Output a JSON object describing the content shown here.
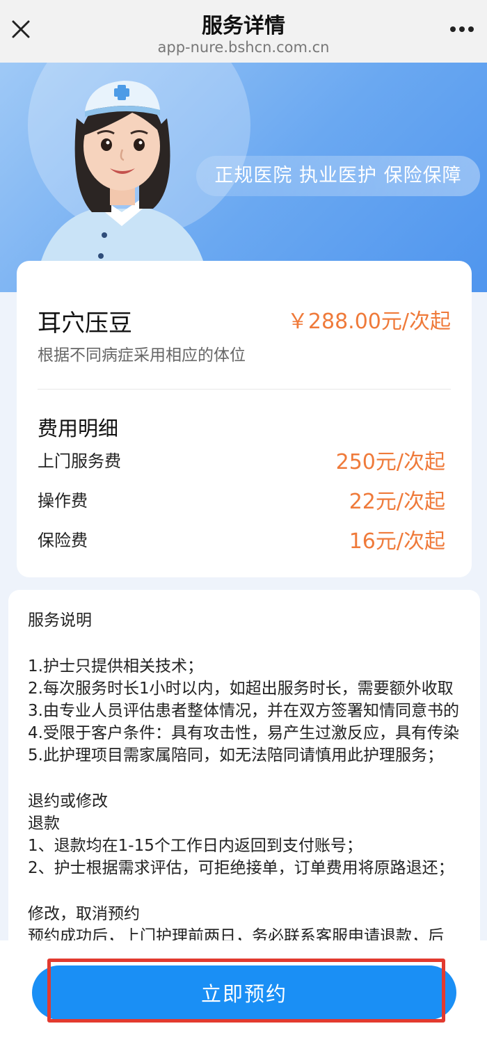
{
  "topbar": {
    "title": "服务详情",
    "url": "app-nure.bshcn.com.cn",
    "close_icon": "close-icon",
    "more_icon": "more-dots-icon"
  },
  "hero": {
    "slogan": "正规医院 执业医护 保险保障",
    "avatar": "nurse-avatar"
  },
  "service": {
    "name": "耳穴压豆",
    "price": "￥288.00元/次起",
    "description": "根据不同病症采用相应的体位"
  },
  "fees": {
    "title": "费用明细",
    "items": [
      {
        "label": "上门服务费",
        "value": "250元/次起"
      },
      {
        "label": "操作费",
        "value": "22元/次起"
      },
      {
        "label": "保险费",
        "value": "16元/次起"
      }
    ]
  },
  "notes": {
    "heading": "服务说明",
    "items": [
      "1.护士只提供相关技术；",
      "2.每次服务时长1小时以内，如超出服务时长，需要额外收取",
      "3.由专业人员评估患者整体情况，并在双方签署知情同意书的",
      "4.受限于客户条件：具有攻击性，易产生过激反应，具有传染",
      "5.此护理项目需家属陪同，如无法陪同请慎用此护理服务；"
    ],
    "refund_heading": "退约或修改",
    "refund_sub": "退款",
    "refund_items": [
      "1、退款均在1-15个工作日内返回到支付账号；",
      "2、护士根据需求评估，可拒绝接单，订单费用将原路退还；"
    ],
    "modify_heading": "修改，取消预约",
    "modify_partial": "预约成功后，上门护理前两日，务必联系客服申请退款，后"
  },
  "action": {
    "book_label": "立即预约"
  },
  "colors": {
    "accent": "#1a8ff5",
    "price": "#ef7a3a",
    "highlight": "#e23a2f"
  }
}
